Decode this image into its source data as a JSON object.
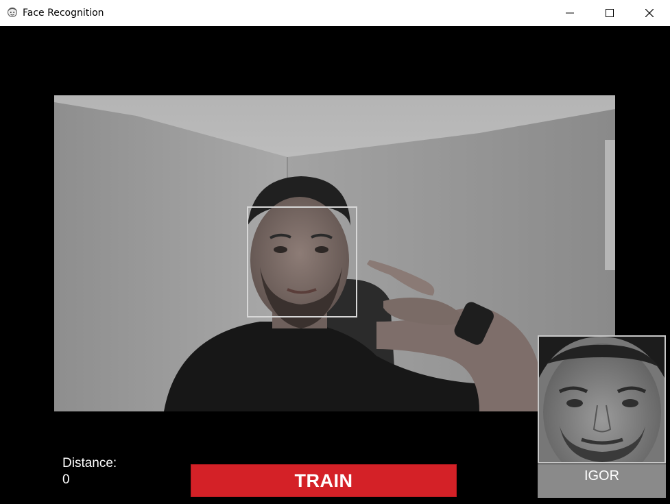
{
  "window": {
    "title": "Face Recognition",
    "icon": "face-app-icon",
    "controls": [
      "minimize-icon",
      "maximize-icon",
      "close-icon"
    ]
  },
  "detection": {
    "distance_label": "Distance:",
    "distance_value": "0",
    "recognized_name": "IGOR"
  },
  "actions": {
    "train_label": "TRAIN"
  },
  "colors": {
    "background": "#000000",
    "train_button": "#d42127",
    "name_box": "#8a8a8a",
    "face_box_border": "#d8d8d8"
  }
}
